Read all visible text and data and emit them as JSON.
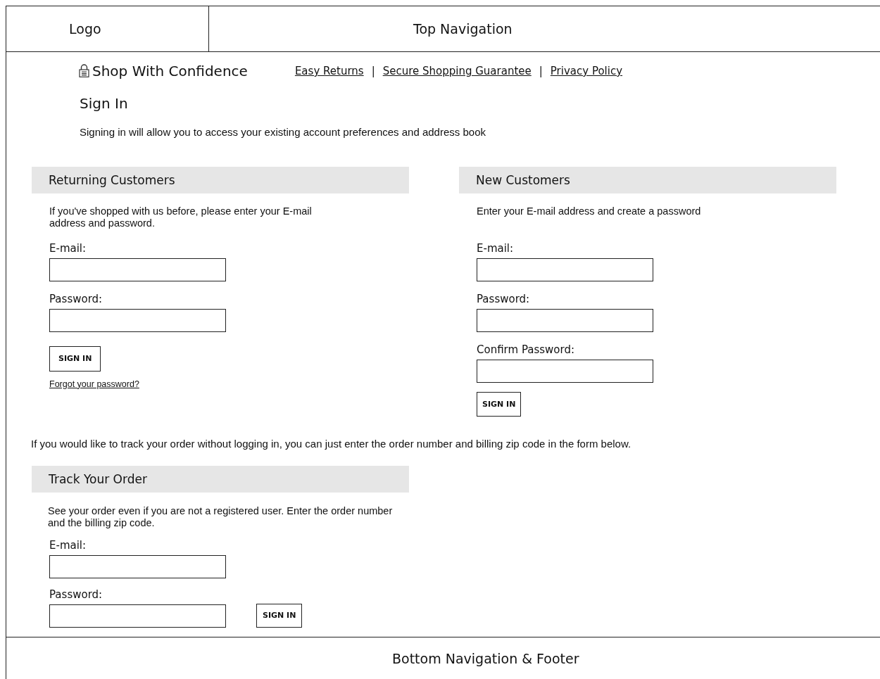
{
  "header": {
    "logo": "Logo",
    "top_navigation": "Top Navigation"
  },
  "trust_bar": {
    "title": "Shop With Confidence",
    "links": [
      "Easy Returns",
      "Secure Shopping Guarantee",
      "Privacy Policy"
    ],
    "separators": [
      "|",
      "|"
    ]
  },
  "page_title": "Sign In",
  "intro": "Signing in will allow you to access your existing account preferences and address book",
  "panels": [
    {
      "title": "Returning Customers",
      "description": "If you've shopped with us before, please enter your E-mail address and password.",
      "fields": [
        {
          "label": "E-mail:"
        },
        {
          "label": "Password:"
        }
      ],
      "button": "SIGN IN",
      "link": "Forgot your password?"
    },
    {
      "title": "New Customers",
      "description": "Enter your E-mail address and create a password",
      "fields": [
        {
          "label": "E-mail:"
        },
        {
          "label": "Password:"
        },
        {
          "label": "Confirm Password:"
        }
      ],
      "button": "SIGN IN"
    }
  ],
  "track_note": "If you would like to track your order without logging in, you can just enter the order number and billing zip code in the form below.",
  "track": {
    "title": "Track Your Order",
    "description": "See your order even if you are not a registered user. Enter the order number and the billing zip code.",
    "fields": [
      {
        "label": "E-mail:"
      },
      {
        "label": "Password:"
      }
    ],
    "button": "SIGN IN"
  },
  "footer": "Bottom Navigation & Footer"
}
